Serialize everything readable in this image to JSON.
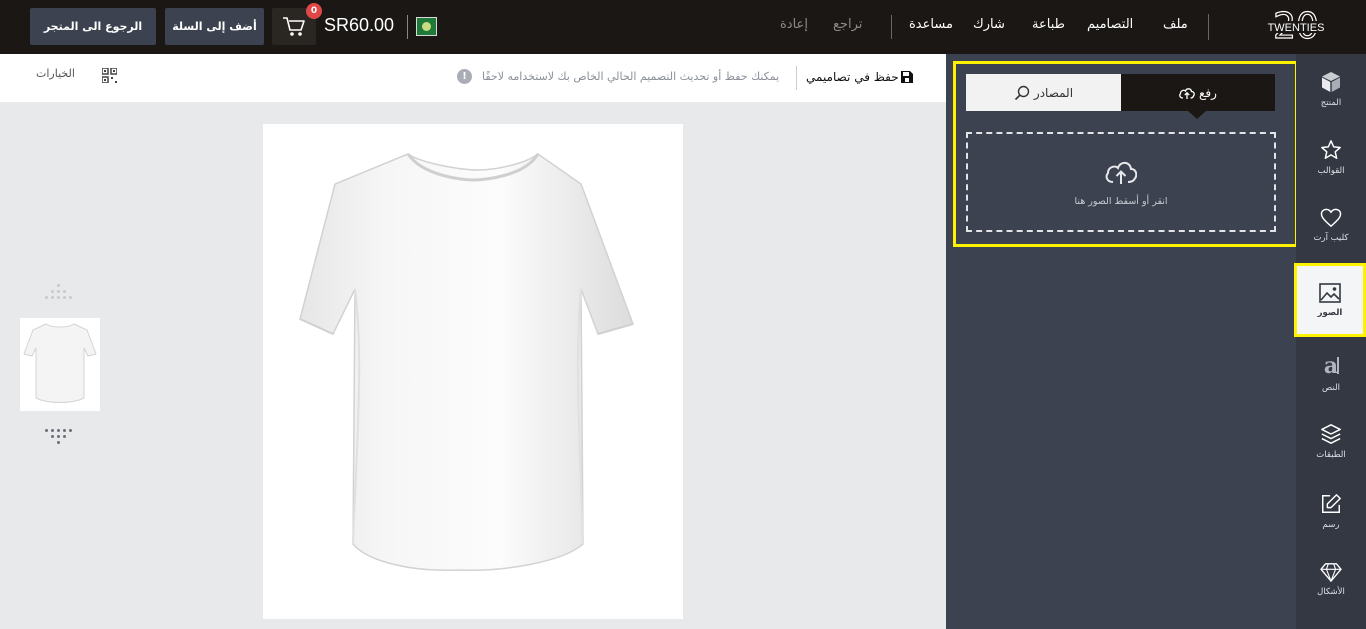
{
  "header": {
    "back_to_store_label": "الرجوع الى المتجر",
    "add_to_cart_label": "أضف إلى السلة",
    "cart_count": "0",
    "price": "SR60.00",
    "menu": {
      "file": "ملف",
      "designs": "التصاميم",
      "print": "طباعة",
      "share": "شارك",
      "help": "مساعدة",
      "undo": "تراجع",
      "redo": "إعادة"
    },
    "logo_number": "20",
    "logo_text": "TWENTIES"
  },
  "infobar": {
    "save_label": "حفظ في تصاميمي",
    "hint": "يمكنك حفظ أو تحديث التصميم الحالي الخاص بك لاستخدامه لاحقًا",
    "alert_glyph": "!",
    "options_label": "الخيارات"
  },
  "panel": {
    "tab_upload": "رفع",
    "tab_sources": "المصادر",
    "dropzone_text": "انقر أو أسقط الصور هنا"
  },
  "sidebar": {
    "items": [
      {
        "label": "المنتج",
        "icon": "cube-icon"
      },
      {
        "label": "القوالب",
        "icon": "star-icon"
      },
      {
        "label": "كليب آرت",
        "icon": "heart-icon"
      },
      {
        "label": "الصور",
        "icon": "image-icon",
        "active": true
      },
      {
        "label": "النص",
        "icon": "text-icon"
      },
      {
        "label": "الطبقات",
        "icon": "layers-icon"
      },
      {
        "label": "رسم",
        "icon": "edit-icon"
      },
      {
        "label": "الأشكال",
        "icon": "diamond-icon"
      }
    ]
  },
  "colors": {
    "topbar": "#1a1714",
    "panel": "#3d4250",
    "sidebar": "#333842",
    "highlight": "#fff200",
    "badge": "#e04848"
  }
}
